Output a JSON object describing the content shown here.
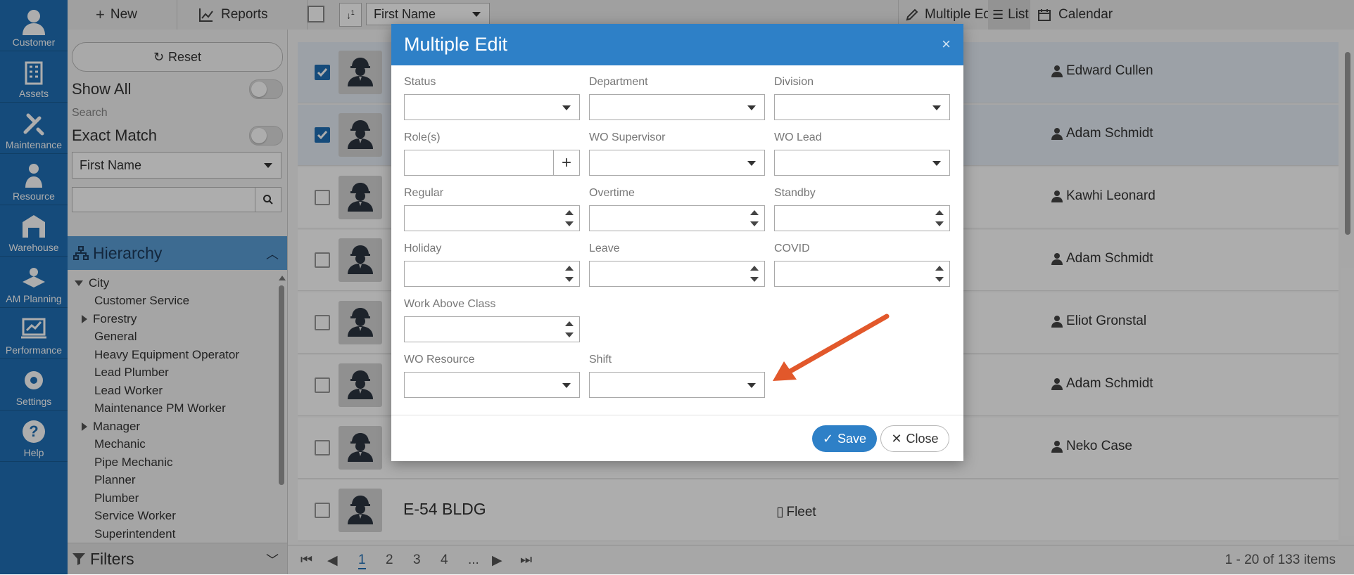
{
  "nav": {
    "items": [
      {
        "label": "Customer",
        "icon": "customer-icon"
      },
      {
        "label": "Assets",
        "icon": "assets-icon"
      },
      {
        "label": "Maintenance",
        "icon": "maintenance-icon"
      },
      {
        "label": "Resource",
        "icon": "resource-icon"
      },
      {
        "label": "Warehouse",
        "icon": "warehouse-icon"
      },
      {
        "label": "AM Planning",
        "icon": "am-planning-icon"
      },
      {
        "label": "Performance",
        "icon": "performance-icon"
      },
      {
        "label": "Settings",
        "icon": "settings-icon"
      },
      {
        "label": "Help",
        "icon": "help-icon"
      }
    ]
  },
  "toolbar": {
    "new_label": "New",
    "reports_label": "Reports",
    "sort_field": "First Name",
    "multiple_edit_label": "Multiple Edit",
    "list_label": "List",
    "calendar_label": "Calendar"
  },
  "left_panel": {
    "reset_label": "Reset",
    "show_all_label": "Show All",
    "search_label": "Search",
    "exact_match_label": "Exact Match",
    "search_field": "First Name",
    "hierarchy_label": "Hierarchy",
    "filters_label": "Filters",
    "tree": [
      {
        "label": "City",
        "level": 0,
        "expander": "down"
      },
      {
        "label": "Customer Service",
        "level": 1,
        "expander": "none"
      },
      {
        "label": "Forestry",
        "level": 1,
        "expander": "right"
      },
      {
        "label": "General",
        "level": 1,
        "expander": "none"
      },
      {
        "label": "Heavy Equipment Operator",
        "level": 1,
        "expander": "none"
      },
      {
        "label": "Lead Plumber",
        "level": 1,
        "expander": "none"
      },
      {
        "label": "Lead Worker",
        "level": 1,
        "expander": "none"
      },
      {
        "label": "Maintenance PM Worker",
        "level": 1,
        "expander": "none"
      },
      {
        "label": "Manager",
        "level": 1,
        "expander": "right"
      },
      {
        "label": "Mechanic",
        "level": 1,
        "expander": "none"
      },
      {
        "label": "Pipe Mechanic",
        "level": 1,
        "expander": "none"
      },
      {
        "label": "Planner",
        "level": 1,
        "expander": "none"
      },
      {
        "label": "Plumber",
        "level": 1,
        "expander": "none"
      },
      {
        "label": "Service Worker",
        "level": 1,
        "expander": "none"
      },
      {
        "label": "Superintendent",
        "level": 1,
        "expander": "none"
      }
    ]
  },
  "list": {
    "rows": [
      {
        "checked": true,
        "person": "Edward Cullen",
        "title": "",
        "category": ""
      },
      {
        "checked": true,
        "person": "Adam Schmidt",
        "title": "",
        "category": ""
      },
      {
        "checked": false,
        "person": "Kawhi Leonard",
        "title": "",
        "category": ""
      },
      {
        "checked": false,
        "person": "Adam Schmidt",
        "title": "",
        "category": ""
      },
      {
        "checked": false,
        "person": "Eliot Gronstal",
        "title": "",
        "category": ""
      },
      {
        "checked": false,
        "person": "Adam Schmidt",
        "title": "",
        "category": ""
      },
      {
        "checked": false,
        "person": "Neko Case",
        "title": "",
        "category": ""
      },
      {
        "checked": false,
        "person": "",
        "title": "E-54   BLDG",
        "category": "Fleet"
      }
    ]
  },
  "pager": {
    "pages": [
      "1",
      "2",
      "3",
      "4",
      "..."
    ],
    "current": "1",
    "summary": "1 - 20 of 133 items"
  },
  "modal": {
    "title": "Multiple Edit",
    "close_glyph": "×",
    "fields": {
      "status": "Status",
      "department": "Department",
      "division": "Division",
      "roles": "Role(s)",
      "wo_supervisor": "WO Supervisor",
      "wo_lead": "WO Lead",
      "regular": "Regular",
      "overtime": "Overtime",
      "standby": "Standby",
      "holiday": "Holiday",
      "leave": "Leave",
      "covid": "COVID",
      "work_above_class": "Work Above Class",
      "wo_resource": "WO Resource",
      "shift": "Shift"
    },
    "save_label": "Save",
    "close_label": "Close"
  },
  "colors": {
    "nav_bg": "#1f6fb5",
    "modal_header": "#2e80c7",
    "save_button": "#2e80c7",
    "arrow": "#e2582b"
  }
}
